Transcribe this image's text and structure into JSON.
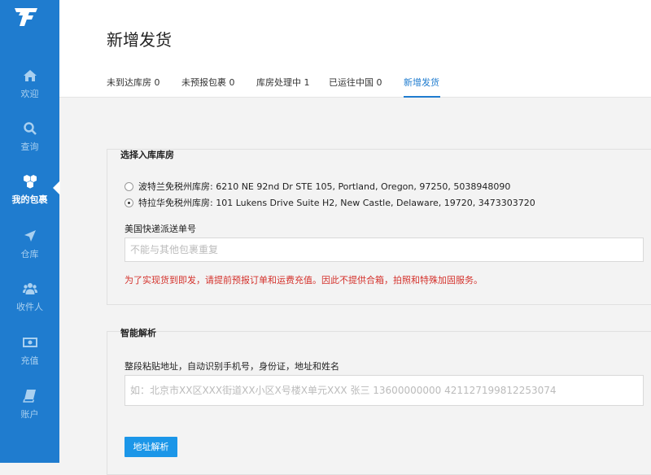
{
  "sidebar": {
    "logo": "JT-logo",
    "items": [
      {
        "label": "欢迎",
        "icon": "home-icon"
      },
      {
        "label": "查询",
        "icon": "search-icon"
      },
      {
        "label": "我的包裹",
        "icon": "packages-icon"
      },
      {
        "label": "仓库",
        "icon": "location-arrow-icon"
      },
      {
        "label": "收件人",
        "icon": "users-icon"
      },
      {
        "label": "充值",
        "icon": "money-icon"
      },
      {
        "label": "账户",
        "icon": "book-icon"
      }
    ],
    "active_index": 2
  },
  "header": {
    "title": "新增发货",
    "tabs": [
      {
        "label": "未到达库房 0"
      },
      {
        "label": "未预报包裹 0"
      },
      {
        "label": "库房处理中 1"
      },
      {
        "label": "已运往中国 0"
      },
      {
        "label": "新增发货"
      }
    ],
    "active_tab": 4
  },
  "warehouse_section": {
    "title": "选择入库库房",
    "options": [
      {
        "label": "波特兰免税州库房: 6210 NE 92nd Dr STE 105, Portland, Oregon, 97250, 5038948090",
        "checked": false
      },
      {
        "label": "特拉华免税州库房: 101 Lukens Drive Suite H2, New Castle, Delaware, 19720, 3473303720",
        "checked": true
      }
    ],
    "tracking_label": "美国快递派送单号",
    "tracking_placeholder": "不能与其他包裹重复",
    "tracking_value": "",
    "notice": "为了实现货到即发，请提前预报订单和运费充值。因此不提供合箱，拍照和特殊加固服务。"
  },
  "smart_parse_section": {
    "title": "智能解析",
    "field_label": "整段粘贴地址，自动识别手机号，身份证，地址和姓名",
    "placeholder": "如：北京市XX区XXX街道XX小区X号楼X单元XXX 张三 13600000000 421127199812253074",
    "button_label": "地址解析"
  },
  "colors": {
    "sidebar": "#1f7ccf",
    "accent": "#1f7ccf",
    "button": "#1b96e8",
    "warning": "#d4312b"
  }
}
